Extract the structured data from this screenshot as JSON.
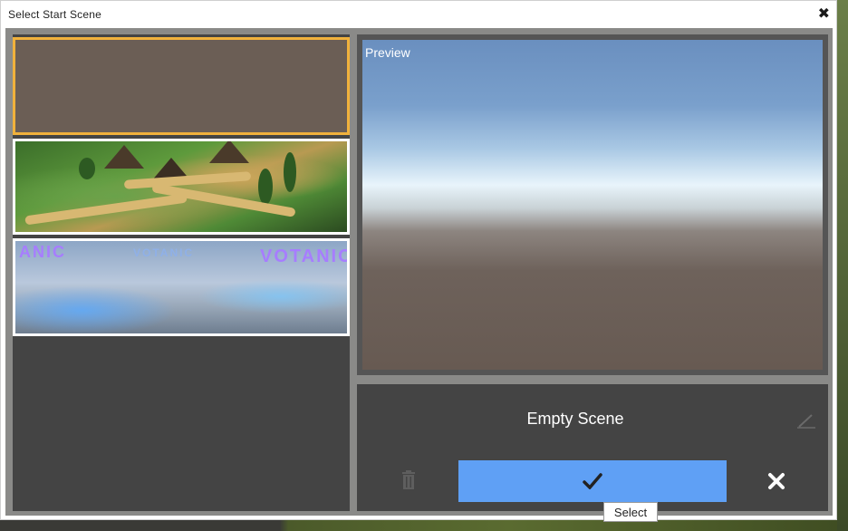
{
  "window": {
    "title": "Select Start Scene",
    "close_icon": "close-icon"
  },
  "scene_list": {
    "items": [
      {
        "name": "Empty Scene",
        "thumbnail": "empty-thumbnail",
        "selected": true
      },
      {
        "name": "",
        "thumbnail": "village-thumbnail",
        "selected": false
      },
      {
        "name": "",
        "thumbnail": "votanic-lab-thumbnail",
        "selected": false,
        "thumbnail_text": "VOTANIC"
      }
    ]
  },
  "preview": {
    "label": "Preview"
  },
  "details": {
    "scene_name": "Empty Scene",
    "edit_icon": "pencil-icon",
    "delete_icon": "trash-icon",
    "confirm_icon": "checkmark-icon",
    "cancel_icon": "close-icon"
  },
  "tooltip": {
    "text": "Select"
  },
  "colors": {
    "selection_border": "#f0b13c",
    "confirm_button": "#5fa0f5",
    "panel_bg": "#444444"
  }
}
